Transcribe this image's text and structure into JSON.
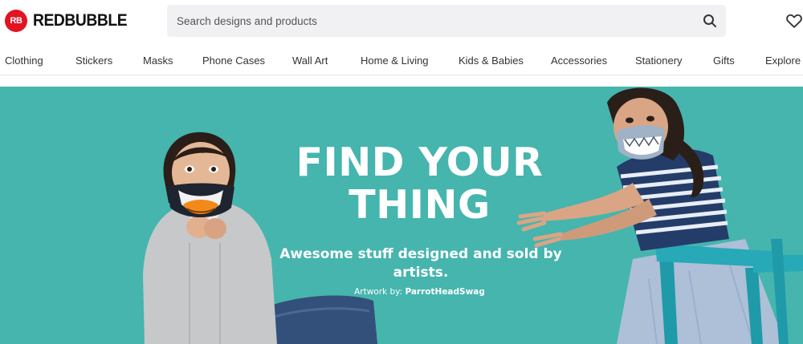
{
  "brand": {
    "name": "REDBUBBLE",
    "mark_text": "RB",
    "color": "#e41321"
  },
  "search": {
    "placeholder": "Search designs and products",
    "icon": "search-icon"
  },
  "header": {
    "wishlist_icon": "heart-icon"
  },
  "nav": {
    "items": [
      {
        "label": "Clothing"
      },
      {
        "label": "Stickers"
      },
      {
        "label": "Masks"
      },
      {
        "label": "Phone Cases"
      },
      {
        "label": "Wall Art"
      },
      {
        "label": "Home & Living"
      },
      {
        "label": "Kids & Babies"
      },
      {
        "label": "Accessories"
      },
      {
        "label": "Stationery"
      },
      {
        "label": "Gifts"
      },
      {
        "label": "Explore d"
      }
    ]
  },
  "hero": {
    "title_line1": "FIND YOUR",
    "title_line2": "THING",
    "subtitle": "Awesome stuff designed and sold by artists.",
    "credit_prefix": "Artwork by: ",
    "credit_artist": "ParrotHeadSwag",
    "background": "#45b5ae"
  }
}
